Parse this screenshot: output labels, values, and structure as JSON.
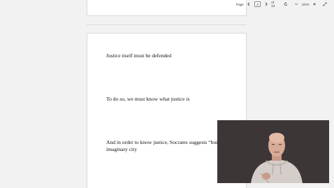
{
  "toolbar": {
    "page_label": "Page",
    "current_page": "3",
    "of_label": "of 13",
    "zoom_level": "100%",
    "icons": [
      "chevron-left-icon",
      "chevron-right-icon",
      "rotate-icon",
      "zoom-out-icon",
      "zoom-in-icon",
      "fullscreen-icon"
    ]
  },
  "slide": {
    "line1": "Justice itself must be defended",
    "line2": "To do so, we must know what justice is",
    "line3": "And in order to know justice, Socrates suggests “building” an imaginary city"
  },
  "video": {
    "description_icon": "presenter-video",
    "background_color": "#3b3535"
  }
}
